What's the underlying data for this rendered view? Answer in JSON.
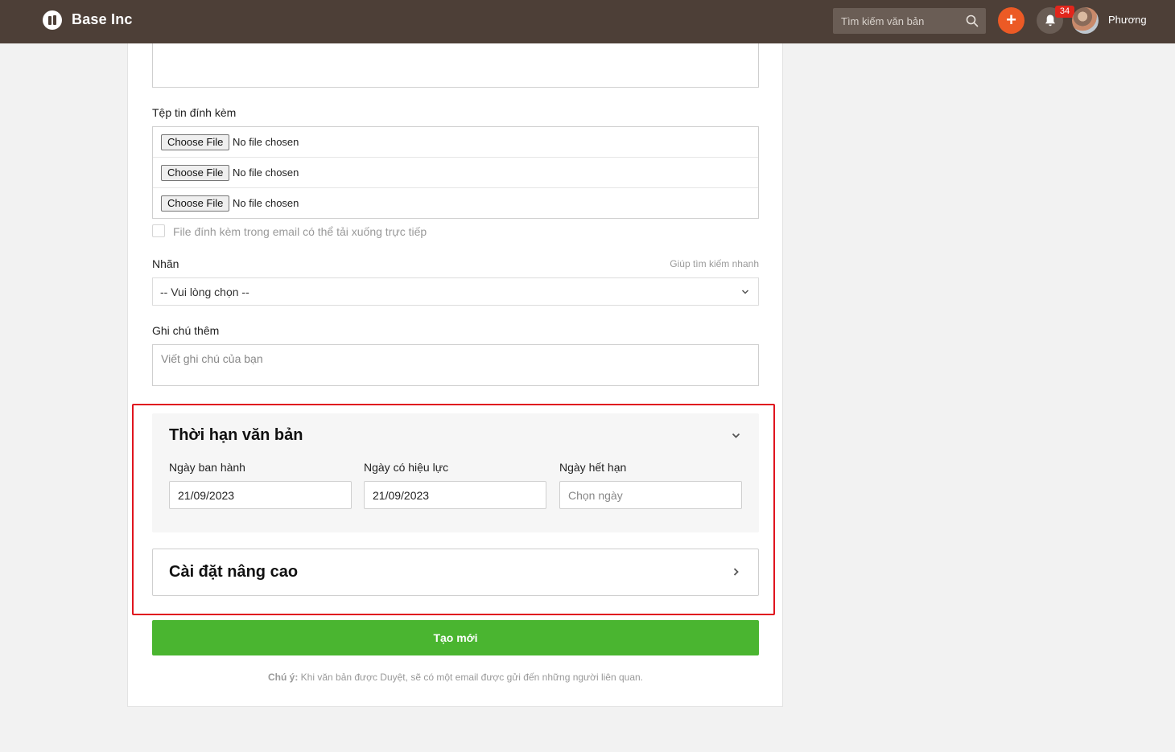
{
  "app": {
    "brand": "Base Inc"
  },
  "header": {
    "search_placeholder": "Tìm kiếm văn bản",
    "add_label": "+",
    "notification_count": "34",
    "user_name": "Phương"
  },
  "attachments": {
    "label": "Tệp tin đính kèm",
    "files": [
      {
        "button": "Choose File",
        "status": "No file chosen"
      },
      {
        "button": "Choose File",
        "status": "No file chosen"
      },
      {
        "button": "Choose File",
        "status": "No file chosen"
      }
    ],
    "direct_download_label": "File đính kèm trong email có thể tải xuống trực tiếp"
  },
  "tags": {
    "label": "Nhãn",
    "hint": "Giúp tìm kiếm nhanh",
    "selected": "-- Vui lòng chọn --"
  },
  "notes": {
    "label": "Ghi chú thêm",
    "placeholder": "Viết ghi chú của bạn"
  },
  "deadline": {
    "title": "Thời hạn văn bản",
    "issue_date_label": "Ngày ban hành",
    "issue_date_value": "21/09/2023",
    "effective_date_label": "Ngày có hiệu lực",
    "effective_date_value": "21/09/2023",
    "expiry_date_label": "Ngày hết hạn",
    "expiry_date_placeholder": "Chọn ngày"
  },
  "advanced": {
    "title": "Cài đặt nâng cao"
  },
  "submit": {
    "label": "Tạo mới"
  },
  "footer_note": {
    "prefix": "Chú ý:",
    "text": "Khi văn bản được Duyệt, sẽ có một email được gửi đến những người liên quan."
  },
  "colors": {
    "topbar": "#4d3f37",
    "accent_orange": "#ec5a25",
    "badge_red": "#e1261c",
    "submit_green": "#4ab530",
    "highlight_red": "#e0141e"
  }
}
